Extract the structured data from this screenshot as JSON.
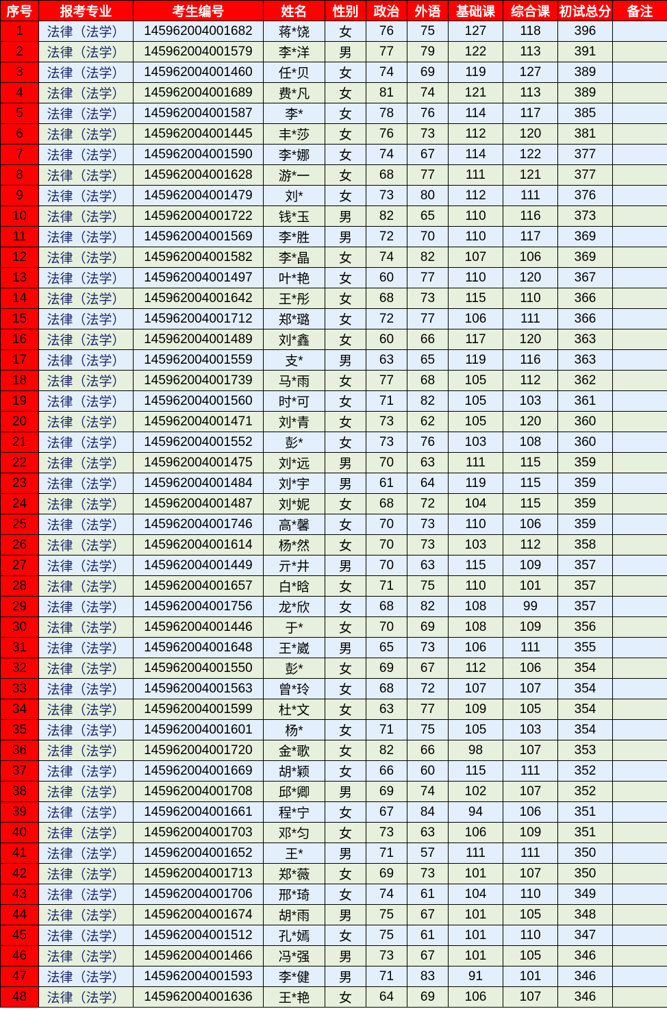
{
  "headers": [
    "序号",
    "报考专业",
    "考生编号",
    "姓名",
    "性别",
    "政治",
    "外语",
    "基础课",
    "综合课",
    "初试总分",
    "备注"
  ],
  "rows": [
    {
      "seq": "1",
      "major": "法律（法学）",
      "id": "145962004001682",
      "name": "蒋*饶",
      "gender": "女",
      "pol": "76",
      "lang": "75",
      "base": "127",
      "comp": "118",
      "total": "396",
      "note": ""
    },
    {
      "seq": "2",
      "major": "法律（法学）",
      "id": "145962004001579",
      "name": "李*洋",
      "gender": "男",
      "pol": "77",
      "lang": "79",
      "base": "122",
      "comp": "113",
      "total": "391",
      "note": ""
    },
    {
      "seq": "3",
      "major": "法律（法学）",
      "id": "145962004001460",
      "name": "任*贝",
      "gender": "女",
      "pol": "74",
      "lang": "69",
      "base": "119",
      "comp": "127",
      "total": "389",
      "note": ""
    },
    {
      "seq": "4",
      "major": "法律（法学）",
      "id": "145962004001689",
      "name": "费*凡",
      "gender": "女",
      "pol": "81",
      "lang": "74",
      "base": "121",
      "comp": "113",
      "total": "389",
      "note": ""
    },
    {
      "seq": "5",
      "major": "法律（法学）",
      "id": "145962004001587",
      "name": "李*",
      "gender": "女",
      "pol": "78",
      "lang": "76",
      "base": "114",
      "comp": "117",
      "total": "385",
      "note": ""
    },
    {
      "seq": "6",
      "major": "法律（法学）",
      "id": "145962004001445",
      "name": "丰*莎",
      "gender": "女",
      "pol": "76",
      "lang": "73",
      "base": "112",
      "comp": "120",
      "total": "381",
      "note": ""
    },
    {
      "seq": "7",
      "major": "法律（法学）",
      "id": "145962004001590",
      "name": "李*娜",
      "gender": "女",
      "pol": "74",
      "lang": "67",
      "base": "114",
      "comp": "122",
      "total": "377",
      "note": ""
    },
    {
      "seq": "8",
      "major": "法律（法学）",
      "id": "145962004001628",
      "name": "游*一",
      "gender": "女",
      "pol": "68",
      "lang": "77",
      "base": "111",
      "comp": "121",
      "total": "377",
      "note": ""
    },
    {
      "seq": "9",
      "major": "法律（法学）",
      "id": "145962004001479",
      "name": "刘*",
      "gender": "女",
      "pol": "73",
      "lang": "80",
      "base": "112",
      "comp": "111",
      "total": "376",
      "note": ""
    },
    {
      "seq": "10",
      "major": "法律（法学）",
      "id": "145962004001722",
      "name": "钱*玉",
      "gender": "男",
      "pol": "82",
      "lang": "65",
      "base": "110",
      "comp": "116",
      "total": "373",
      "note": ""
    },
    {
      "seq": "11",
      "major": "法律（法学）",
      "id": "145962004001569",
      "name": "李*胜",
      "gender": "男",
      "pol": "72",
      "lang": "70",
      "base": "110",
      "comp": "117",
      "total": "369",
      "note": ""
    },
    {
      "seq": "12",
      "major": "法律（法学）",
      "id": "145962004001582",
      "name": "李*晶",
      "gender": "女",
      "pol": "74",
      "lang": "82",
      "base": "107",
      "comp": "106",
      "total": "369",
      "note": ""
    },
    {
      "seq": "13",
      "major": "法律（法学）",
      "id": "145962004001497",
      "name": "叶*艳",
      "gender": "女",
      "pol": "60",
      "lang": "77",
      "base": "110",
      "comp": "120",
      "total": "367",
      "note": ""
    },
    {
      "seq": "14",
      "major": "法律（法学）",
      "id": "145962004001642",
      "name": "王*彤",
      "gender": "女",
      "pol": "68",
      "lang": "73",
      "base": "115",
      "comp": "110",
      "total": "366",
      "note": ""
    },
    {
      "seq": "15",
      "major": "法律（法学）",
      "id": "145962004001712",
      "name": "郑*璐",
      "gender": "女",
      "pol": "72",
      "lang": "77",
      "base": "106",
      "comp": "111",
      "total": "366",
      "note": ""
    },
    {
      "seq": "16",
      "major": "法律（法学）",
      "id": "145962004001489",
      "name": "刘*鑫",
      "gender": "女",
      "pol": "60",
      "lang": "66",
      "base": "117",
      "comp": "120",
      "total": "363",
      "note": ""
    },
    {
      "seq": "17",
      "major": "法律（法学）",
      "id": "145962004001559",
      "name": "支*",
      "gender": "男",
      "pol": "63",
      "lang": "65",
      "base": "119",
      "comp": "116",
      "total": "363",
      "note": ""
    },
    {
      "seq": "18",
      "major": "法律（法学）",
      "id": "145962004001739",
      "name": "马*雨",
      "gender": "女",
      "pol": "77",
      "lang": "68",
      "base": "105",
      "comp": "112",
      "total": "362",
      "note": ""
    },
    {
      "seq": "19",
      "major": "法律（法学）",
      "id": "145962004001560",
      "name": "时*可",
      "gender": "女",
      "pol": "71",
      "lang": "82",
      "base": "105",
      "comp": "103",
      "total": "361",
      "note": ""
    },
    {
      "seq": "20",
      "major": "法律（法学）",
      "id": "145962004001471",
      "name": "刘*青",
      "gender": "女",
      "pol": "73",
      "lang": "62",
      "base": "105",
      "comp": "120",
      "total": "360",
      "note": ""
    },
    {
      "seq": "21",
      "major": "法律（法学）",
      "id": "145962004001552",
      "name": "彭*",
      "gender": "女",
      "pol": "73",
      "lang": "76",
      "base": "103",
      "comp": "108",
      "total": "360",
      "note": ""
    },
    {
      "seq": "22",
      "major": "法律（法学）",
      "id": "145962004001475",
      "name": "刘*远",
      "gender": "男",
      "pol": "70",
      "lang": "63",
      "base": "111",
      "comp": "115",
      "total": "359",
      "note": ""
    },
    {
      "seq": "23",
      "major": "法律（法学）",
      "id": "145962004001484",
      "name": "刘*宇",
      "gender": "男",
      "pol": "61",
      "lang": "64",
      "base": "119",
      "comp": "115",
      "total": "359",
      "note": ""
    },
    {
      "seq": "24",
      "major": "法律（法学）",
      "id": "145962004001487",
      "name": "刘*妮",
      "gender": "女",
      "pol": "68",
      "lang": "72",
      "base": "104",
      "comp": "115",
      "total": "359",
      "note": ""
    },
    {
      "seq": "25",
      "major": "法律（法学）",
      "id": "145962004001746",
      "name": "高*馨",
      "gender": "女",
      "pol": "70",
      "lang": "73",
      "base": "110",
      "comp": "106",
      "total": "359",
      "note": ""
    },
    {
      "seq": "26",
      "major": "法律（法学）",
      "id": "145962004001614",
      "name": "杨*然",
      "gender": "女",
      "pol": "70",
      "lang": "73",
      "base": "103",
      "comp": "112",
      "total": "358",
      "note": ""
    },
    {
      "seq": "27",
      "major": "法律（法学）",
      "id": "145962004001449",
      "name": "亓*井",
      "gender": "男",
      "pol": "70",
      "lang": "63",
      "base": "115",
      "comp": "109",
      "total": "357",
      "note": ""
    },
    {
      "seq": "28",
      "major": "法律（法学）",
      "id": "145962004001657",
      "name": "白*晗",
      "gender": "女",
      "pol": "71",
      "lang": "75",
      "base": "110",
      "comp": "101",
      "total": "357",
      "note": ""
    },
    {
      "seq": "29",
      "major": "法律（法学）",
      "id": "145962004001756",
      "name": "龙*欣",
      "gender": "女",
      "pol": "68",
      "lang": "82",
      "base": "108",
      "comp": "99",
      "total": "357",
      "note": ""
    },
    {
      "seq": "30",
      "major": "法律（法学）",
      "id": "145962004001446",
      "name": "于*",
      "gender": "女",
      "pol": "70",
      "lang": "69",
      "base": "108",
      "comp": "109",
      "total": "356",
      "note": ""
    },
    {
      "seq": "31",
      "major": "法律（法学）",
      "id": "145962004001648",
      "name": "王*崴",
      "gender": "男",
      "pol": "65",
      "lang": "73",
      "base": "106",
      "comp": "111",
      "total": "355",
      "note": ""
    },
    {
      "seq": "32",
      "major": "法律（法学）",
      "id": "145962004001550",
      "name": "彭*",
      "gender": "女",
      "pol": "69",
      "lang": "67",
      "base": "112",
      "comp": "106",
      "total": "354",
      "note": ""
    },
    {
      "seq": "33",
      "major": "法律（法学）",
      "id": "145962004001563",
      "name": "曾*玲",
      "gender": "女",
      "pol": "68",
      "lang": "72",
      "base": "107",
      "comp": "107",
      "total": "354",
      "note": ""
    },
    {
      "seq": "34",
      "major": "法律（法学）",
      "id": "145962004001599",
      "name": "杜*文",
      "gender": "女",
      "pol": "63",
      "lang": "77",
      "base": "109",
      "comp": "105",
      "total": "354",
      "note": ""
    },
    {
      "seq": "35",
      "major": "法律（法学）",
      "id": "145962004001601",
      "name": "杨*",
      "gender": "女",
      "pol": "71",
      "lang": "75",
      "base": "105",
      "comp": "103",
      "total": "354",
      "note": ""
    },
    {
      "seq": "36",
      "major": "法律（法学）",
      "id": "145962004001720",
      "name": "金*歌",
      "gender": "女",
      "pol": "82",
      "lang": "66",
      "base": "98",
      "comp": "107",
      "total": "353",
      "note": ""
    },
    {
      "seq": "37",
      "major": "法律（法学）",
      "id": "145962004001669",
      "name": "胡*颖",
      "gender": "女",
      "pol": "66",
      "lang": "60",
      "base": "115",
      "comp": "111",
      "total": "352",
      "note": ""
    },
    {
      "seq": "38",
      "major": "法律（法学）",
      "id": "145962004001708",
      "name": "邱*卿",
      "gender": "男",
      "pol": "69",
      "lang": "74",
      "base": "102",
      "comp": "107",
      "total": "352",
      "note": ""
    },
    {
      "seq": "39",
      "major": "法律（法学）",
      "id": "145962004001661",
      "name": "程*宁",
      "gender": "女",
      "pol": "67",
      "lang": "84",
      "base": "94",
      "comp": "106",
      "total": "351",
      "note": ""
    },
    {
      "seq": "40",
      "major": "法律（法学）",
      "id": "145962004001703",
      "name": "邓*匀",
      "gender": "女",
      "pol": "73",
      "lang": "63",
      "base": "106",
      "comp": "109",
      "total": "351",
      "note": ""
    },
    {
      "seq": "41",
      "major": "法律（法学）",
      "id": "145962004001652",
      "name": "王*",
      "gender": "男",
      "pol": "71",
      "lang": "57",
      "base": "111",
      "comp": "111",
      "total": "350",
      "note": ""
    },
    {
      "seq": "42",
      "major": "法律（法学）",
      "id": "145962004001713",
      "name": "郑*薇",
      "gender": "女",
      "pol": "69",
      "lang": "73",
      "base": "101",
      "comp": "107",
      "total": "350",
      "note": ""
    },
    {
      "seq": "43",
      "major": "法律（法学）",
      "id": "145962004001706",
      "name": "邢*琦",
      "gender": "女",
      "pol": "74",
      "lang": "61",
      "base": "104",
      "comp": "110",
      "total": "349",
      "note": ""
    },
    {
      "seq": "44",
      "major": "法律（法学）",
      "id": "145962004001674",
      "name": "胡*雨",
      "gender": "男",
      "pol": "75",
      "lang": "67",
      "base": "101",
      "comp": "105",
      "total": "348",
      "note": ""
    },
    {
      "seq": "45",
      "major": "法律（法学）",
      "id": "145962004001512",
      "name": "孔*嫣",
      "gender": "女",
      "pol": "75",
      "lang": "61",
      "base": "101",
      "comp": "110",
      "total": "347",
      "note": ""
    },
    {
      "seq": "46",
      "major": "法律（法学）",
      "id": "145962004001466",
      "name": "冯*强",
      "gender": "男",
      "pol": "73",
      "lang": "67",
      "base": "101",
      "comp": "105",
      "total": "346",
      "note": ""
    },
    {
      "seq": "47",
      "major": "法律（法学）",
      "id": "145962004001593",
      "name": "李*健",
      "gender": "男",
      "pol": "71",
      "lang": "83",
      "base": "91",
      "comp": "101",
      "total": "346",
      "note": ""
    },
    {
      "seq": "48",
      "major": "法律（法学）",
      "id": "145962004001636",
      "name": "王*艳",
      "gender": "女",
      "pol": "64",
      "lang": "69",
      "base": "106",
      "comp": "107",
      "total": "346",
      "note": ""
    }
  ]
}
